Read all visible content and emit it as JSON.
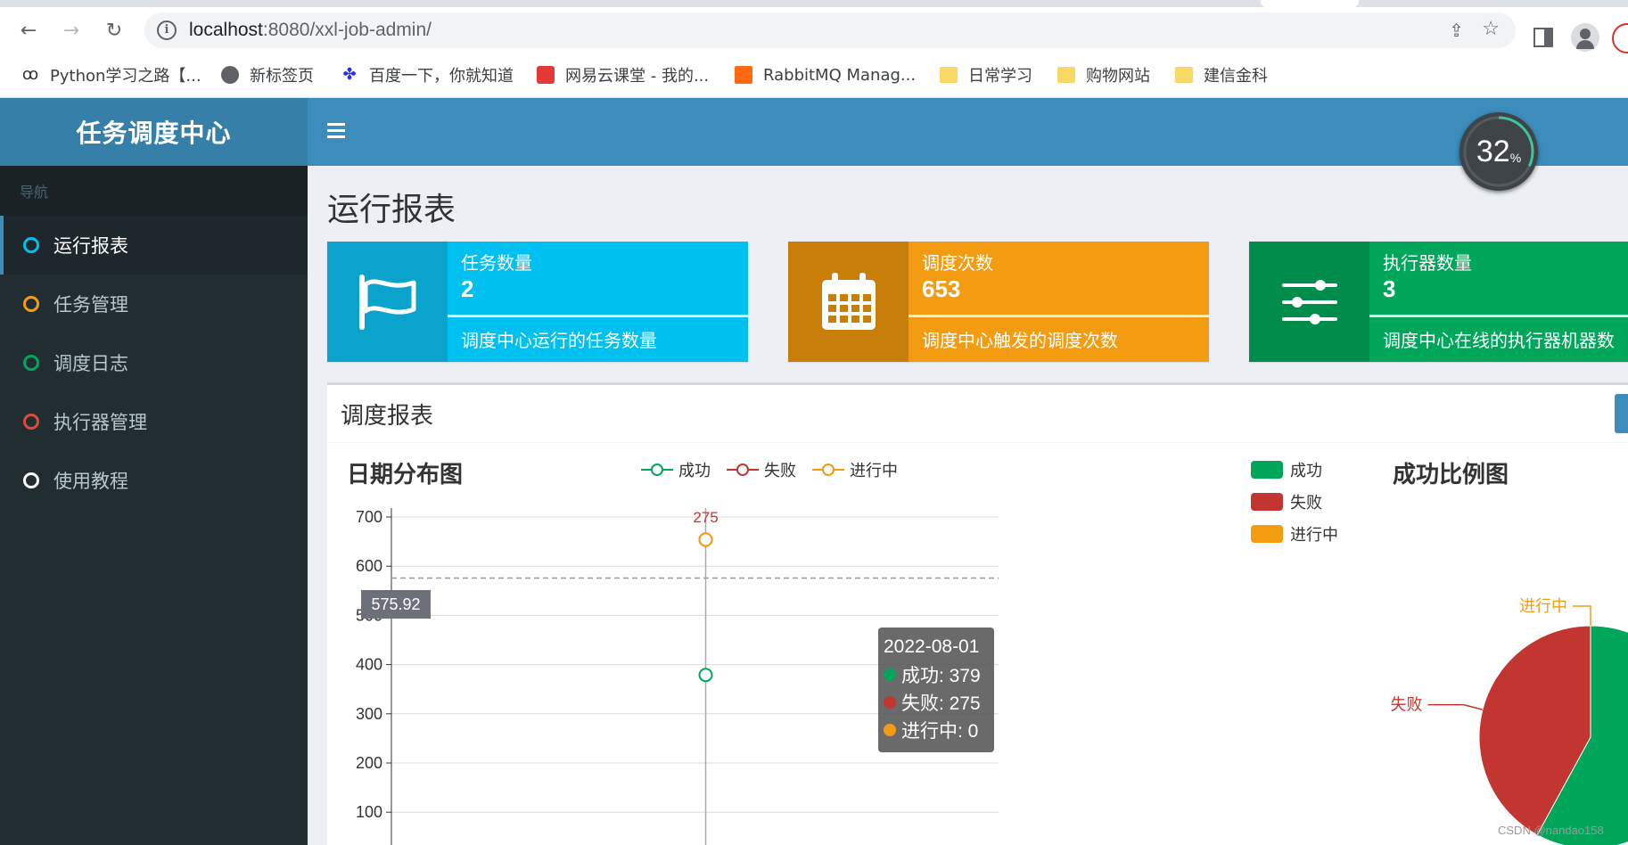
{
  "browser": {
    "url_host": "localhost",
    "url_rest": ":8080/xxl-job-admin/",
    "bookmarks": [
      {
        "label": "Python学习之路【...",
        "icon": "python-icon"
      },
      {
        "label": "新标签页",
        "icon": "globe-icon"
      },
      {
        "label": "百度一下，你就知道",
        "icon": "baidu-paw-icon"
      },
      {
        "label": "网易云课堂 - 我的...",
        "icon": "netease-icon"
      },
      {
        "label": "RabbitMQ Manag...",
        "icon": "rabbitmq-icon"
      },
      {
        "label": "日常学习",
        "icon": "folder-icon"
      },
      {
        "label": "购物网站",
        "icon": "folder-icon"
      },
      {
        "label": "建信金科",
        "icon": "folder-icon"
      }
    ]
  },
  "app": {
    "logo": "任务调度中心",
    "progress_percent": 32,
    "progress_unit": "%"
  },
  "sidebar": {
    "header": "导航",
    "items": [
      {
        "label": "运行报表",
        "color": "#00c0ef",
        "active": true
      },
      {
        "label": "任务管理",
        "color": "#f39c12",
        "active": false
      },
      {
        "label": "调度日志",
        "color": "#00a65a",
        "active": false
      },
      {
        "label": "执行器管理",
        "color": "#dd4b39",
        "active": false
      },
      {
        "label": "使用教程",
        "color": "#ffffff",
        "active": false
      }
    ]
  },
  "main": {
    "title": "运行报表",
    "info_boxes": [
      {
        "label": "任务数量",
        "number": "2",
        "desc": "调度中心运行的任务数量",
        "icon": "flag-icon",
        "color": "#00c0ef",
        "icon_bg": "#0aa3cc"
      },
      {
        "label": "调度次数",
        "number": "653",
        "desc": "调度中心触发的调度次数",
        "icon": "calendar-icon",
        "color": "#f39c12",
        "icon_bg": "#c87f0a"
      },
      {
        "label": "执行器数量",
        "number": "3",
        "desc": "调度中心在线的执行器机器数",
        "icon": "sliders-icon",
        "color": "#00a65a",
        "icon_bg": "#008d4c"
      }
    ],
    "panel_title": "调度报表"
  },
  "chart_data": [
    {
      "type": "line",
      "title": "日期分布图",
      "x": [
        "2022-08-01"
      ],
      "series": [
        {
          "name": "成功",
          "color": "#00a65a",
          "values": [
            379
          ]
        },
        {
          "name": "失败",
          "color": "#c23531",
          "values": [
            275
          ]
        },
        {
          "name": "进行中",
          "color": "#f39c12",
          "values": [
            0
          ]
        }
      ],
      "stacked": true,
      "yticks": [
        100,
        200,
        300,
        400,
        500,
        600,
        700
      ],
      "ylim": [
        0,
        700
      ],
      "point_labels": [
        "275"
      ],
      "axis_pointer_value": "575.92",
      "tooltip": {
        "title": "2022-08-01",
        "rows": [
          {
            "label": "成功: 379",
            "color": "#00a65a"
          },
          {
            "label": "失败: 275",
            "color": "#c23531"
          },
          {
            "label": "进行中: 0",
            "color": "#f39c12"
          }
        ]
      },
      "legend": "top-center",
      "grid": true
    },
    {
      "type": "pie",
      "title": "成功比例图",
      "slices": [
        {
          "label": "成功",
          "value": 379,
          "color": "#00a65a"
        },
        {
          "label": "失败",
          "value": 275,
          "color": "#c23531"
        },
        {
          "label": "进行中",
          "value": 0,
          "color": "#f39c12"
        }
      ],
      "slice_labels": [
        "成功",
        "失败",
        "进行中"
      ],
      "legend": "top-left"
    }
  ],
  "watermark": "CSDN @nandao158"
}
